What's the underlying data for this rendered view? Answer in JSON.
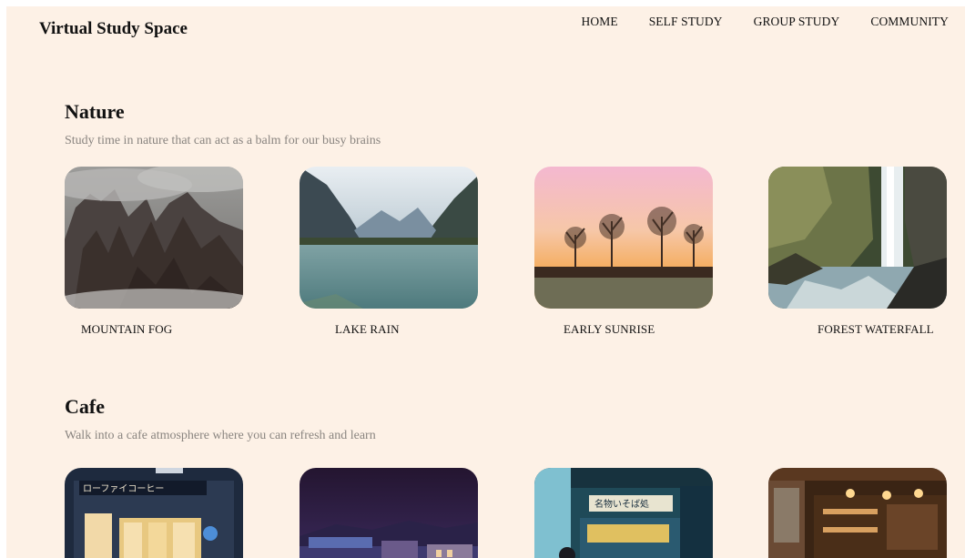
{
  "header": {
    "brand": "Virtual Study Space",
    "nav": [
      "HOME",
      "SELF STUDY",
      "GROUP STUDY",
      "COMMUNITY"
    ]
  },
  "sections": [
    {
      "title": "Nature",
      "subtitle": "Study time in nature that can act as a balm for our busy brains",
      "cards": [
        {
          "label": "MOUNTAIN FOG"
        },
        {
          "label": "LAKE RAIN"
        },
        {
          "label": "EARLY SUNRISE"
        },
        {
          "label": "FOREST WATERFALL"
        }
      ]
    },
    {
      "title": "Cafe",
      "subtitle": "Walk into a cafe atmosphere where you can refresh and learn",
      "cards": [
        {
          "sign": "ローファイコーヒー"
        },
        {},
        {
          "sign": "名物いそば処"
        },
        {}
      ]
    }
  ]
}
